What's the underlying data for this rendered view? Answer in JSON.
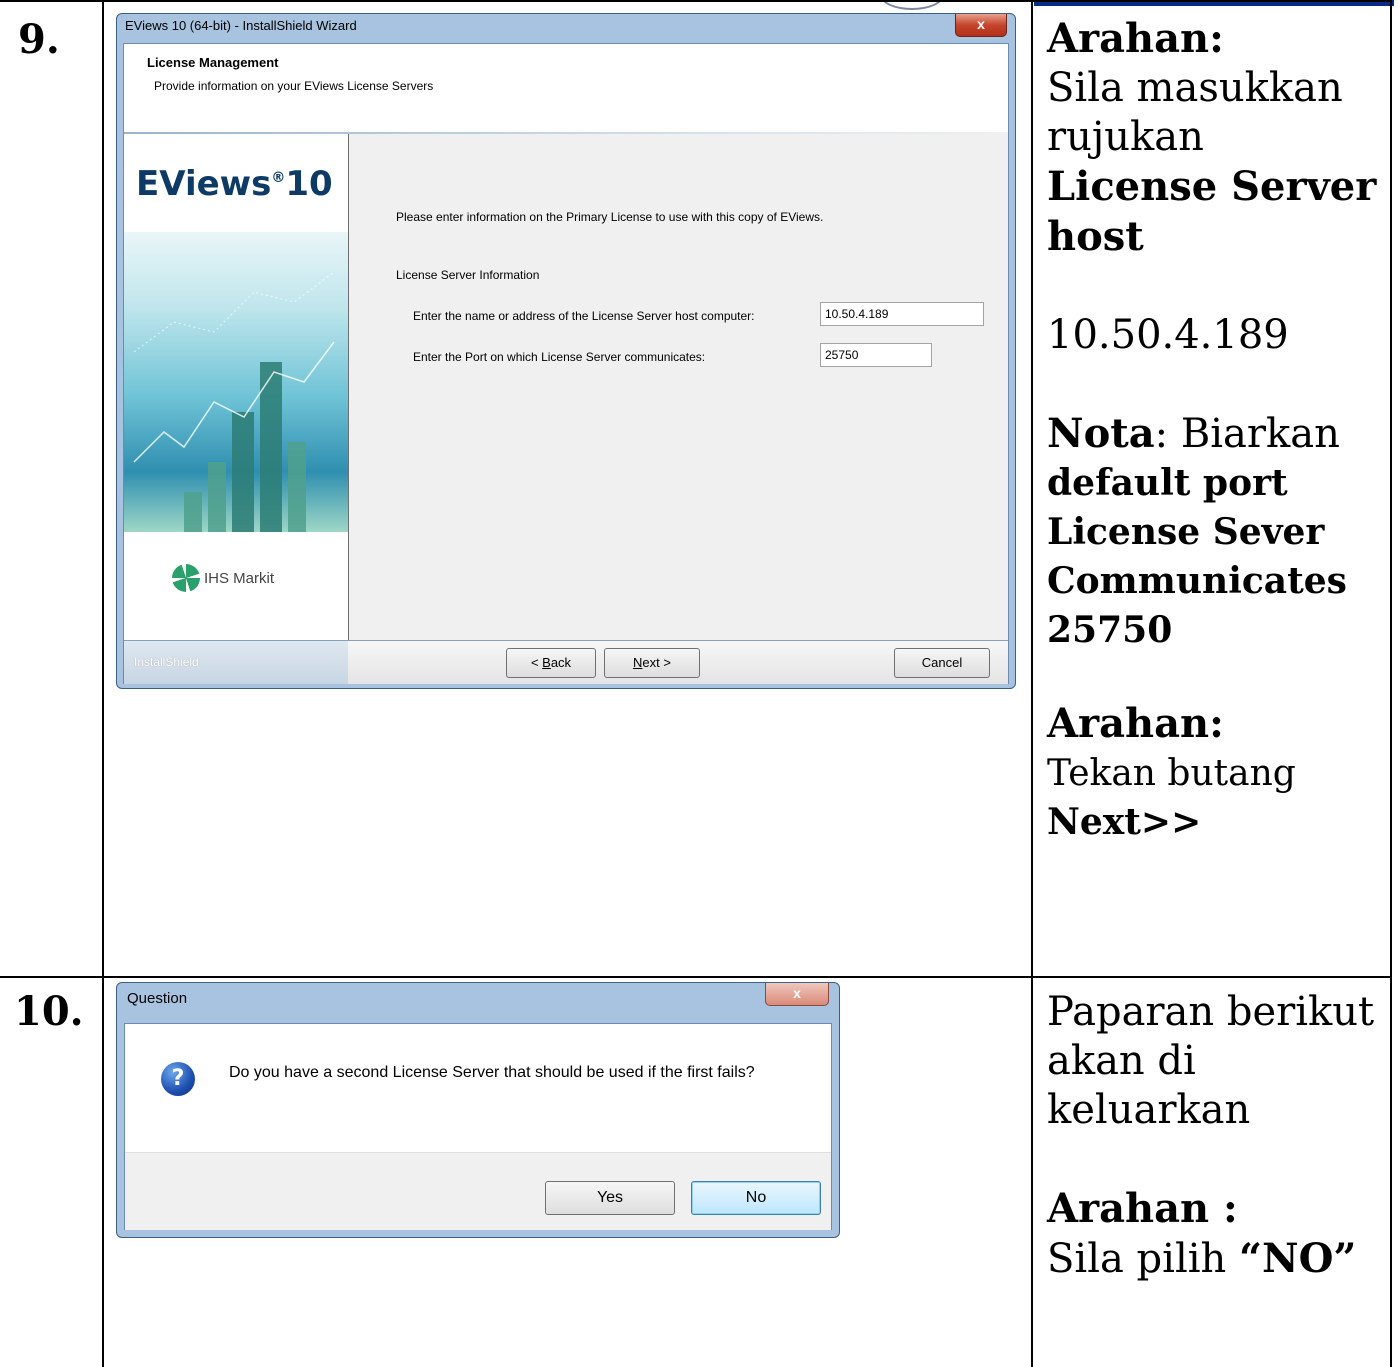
{
  "steps": [
    {
      "number": "9.",
      "instructions": {
        "heading1": "Arahan:",
        "line1": "Sila masukkan rujukan",
        "bold1": "License Server host",
        "value": "10.50.4.189",
        "note_label": "Nota",
        "note_text": ": Biarkan",
        "note_bold": "default port License Sever Communicates 25750",
        "heading2": "Arahan:",
        "line2": "Tekan butang",
        "bold2": "Next>>"
      }
    },
    {
      "number": "10.",
      "instructions": {
        "line1": "Paparan berikut akan di keluarkan",
        "heading": "Arahan :",
        "line2": "Sila pilih",
        "bold": "“NO”"
      }
    }
  ],
  "wizard": {
    "title": "EViews 10 (64-bit) - InstallShield Wizard",
    "close": "x",
    "header_title": "License Management",
    "header_subtitle": "Provide information on your EViews License Servers",
    "brand_name": "EViews",
    "brand_reg": "®",
    "brand_version": "10",
    "vendor": "IHS Markit",
    "intro": "Please enter information on the Primary License to use with this copy of EViews.",
    "section": "License Server Information",
    "host_label": "Enter the name or address of the License Server host computer:",
    "host_value": "10.50.4.189",
    "port_label": "Enter the Port on which License Server communicates:",
    "port_value": "25750",
    "footer_brand": "InstallShield",
    "back_prefix": "< ",
    "back_key": "B",
    "back_rest": "ack",
    "next_key": "N",
    "next_rest": "ext >",
    "cancel": "Cancel"
  },
  "question_dialog": {
    "title": "Question",
    "close": "x",
    "icon": "question-icon",
    "message": "Do you have a second License Server that should be used if the first fails?",
    "yes": "Yes",
    "no": "No"
  },
  "colors": {
    "window_frame": "#a7c3df",
    "brand": "#0e3a66",
    "close_red": "#c4452d"
  }
}
